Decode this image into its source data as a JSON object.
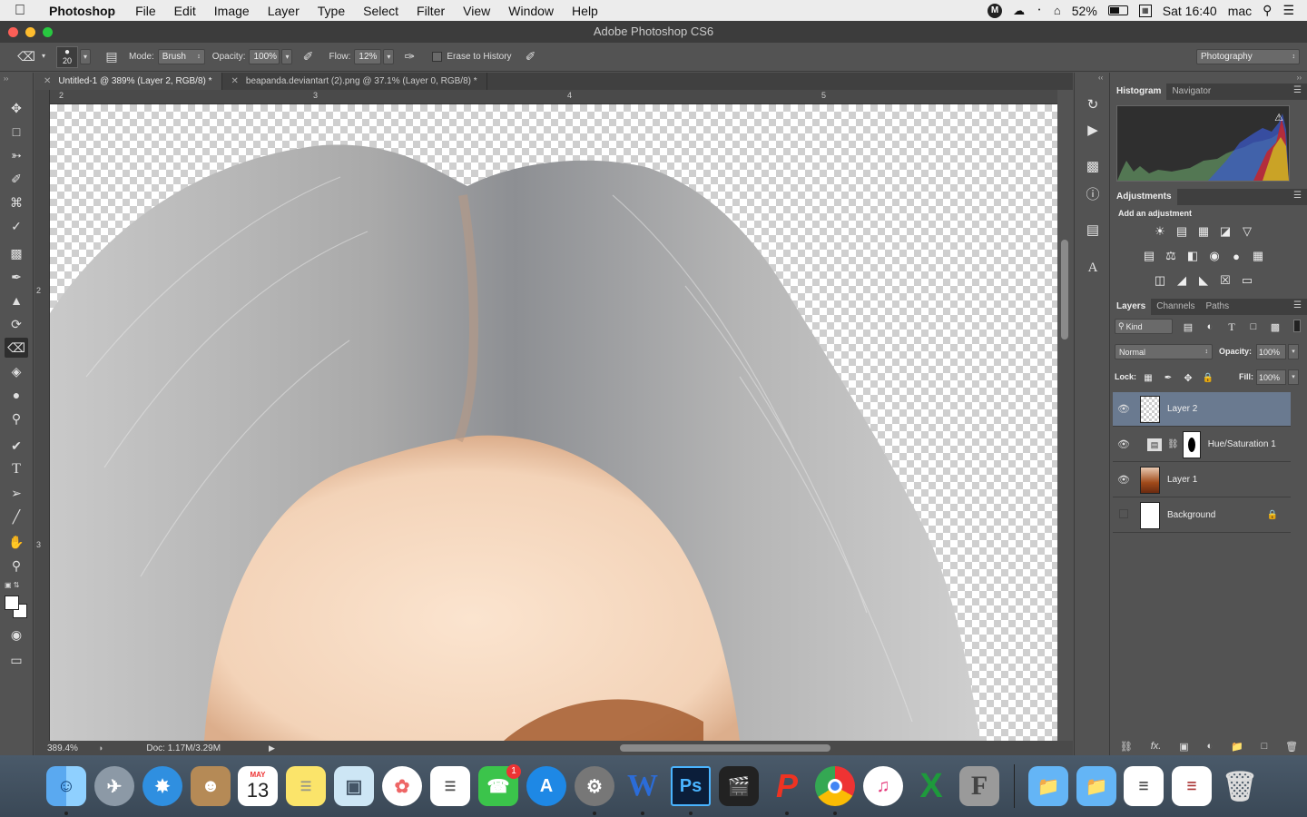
{
  "menubar": {
    "app_name": "Photoshop",
    "items": [
      "File",
      "Edit",
      "Image",
      "Layer",
      "Type",
      "Select",
      "Filter",
      "View",
      "Window",
      "Help"
    ],
    "battery": "52%",
    "clock": "Sat 16:40",
    "user": "mac"
  },
  "window": {
    "title": "Adobe Photoshop CS6"
  },
  "options": {
    "brush_size": "20",
    "mode_label": "Mode:",
    "mode_value": "Brush",
    "opacity_label": "Opacity:",
    "opacity_value": "100%",
    "flow_label": "Flow:",
    "flow_value": "12%",
    "erase_history_label": "Erase to History",
    "workspace": "Photography"
  },
  "tabs": [
    {
      "label": "Untitled-1 @ 389% (Layer 2, RGB/8) *"
    },
    {
      "label": "beapanda.deviantart (2).png @ 37.1% (Layer 0, RGB/8) *"
    }
  ],
  "rulers": {
    "top": [
      "2",
      "3",
      "4",
      "5"
    ],
    "left": [
      "2",
      "3"
    ]
  },
  "status": {
    "zoom": "389.4%",
    "doc": "Doc: 1.17M/3.29M"
  },
  "histogram_panel": {
    "tabs": [
      "Histogram",
      "Navigator"
    ]
  },
  "adjustments_panel": {
    "tab": "Adjustments",
    "subtitle": "Add an adjustment"
  },
  "layers_panel": {
    "tabs": [
      "Layers",
      "Channels",
      "Paths"
    ],
    "kind_label": "Kind",
    "blend_mode": "Normal",
    "opacity_label": "Opacity:",
    "opacity_value": "100%",
    "lock_label": "Lock:",
    "fill_label": "Fill:",
    "fill_value": "100%",
    "layers": [
      {
        "name": "Layer 2",
        "visible": true,
        "selected": true
      },
      {
        "name": "Hue/Saturation 1",
        "visible": true,
        "selected": false
      },
      {
        "name": "Layer 1",
        "visible": true,
        "selected": false
      },
      {
        "name": "Background",
        "visible": false,
        "selected": false
      }
    ]
  },
  "dock": {
    "calendar_month": "MAY",
    "calendar_day": "13",
    "facetime_badge": "1",
    "word_letter": "W",
    "ps_label": "Ps"
  },
  "colors": {
    "accent_selected_layer": "#6a7a90",
    "ui_gray": "#535353"
  }
}
